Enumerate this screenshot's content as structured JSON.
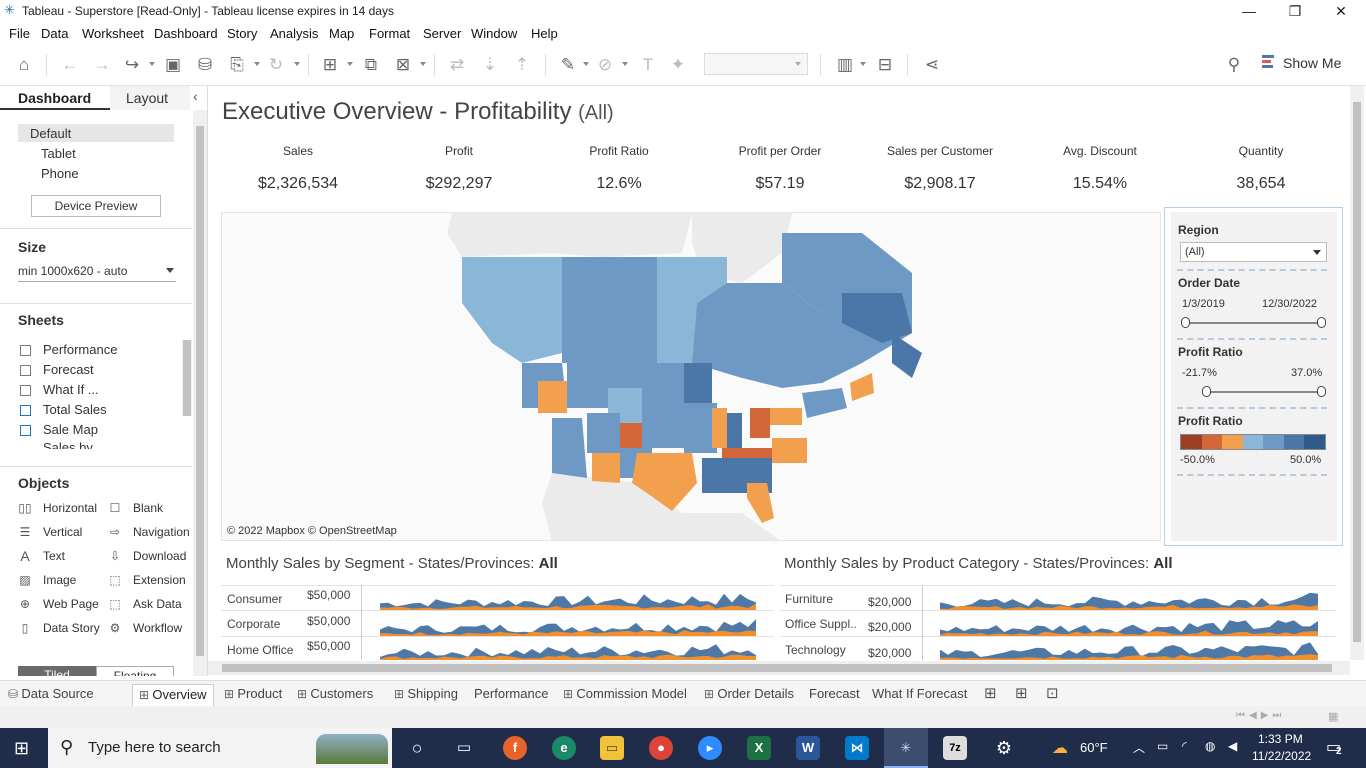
{
  "window": {
    "title": "Tableau - Superstore [Read-Only] - Tableau license expires in 14 days",
    "minimize": "—",
    "restore": "❐",
    "close": "✕"
  },
  "menu": [
    "File",
    "Data",
    "Worksheet",
    "Dashboard",
    "Story",
    "Analysis",
    "Map",
    "Format",
    "Server",
    "Window",
    "Help"
  ],
  "toolbar": {
    "show_me_label": "Show Me",
    "icons": [
      "home-icon",
      "back-icon",
      "forward-icon",
      "redo-icon",
      "save-icon",
      "new-datasource-icon",
      "pause-updates-icon",
      "refresh-icon",
      "new-worksheet-icon",
      "duplicate-icon",
      "clear-icon",
      "swap-icon",
      "sort-ascending-icon",
      "sort-descending-icon",
      "highlight-icon",
      "group-icon",
      "label-icon",
      "pin-icon",
      "chart-icon",
      "presentation-icon",
      "share-icon",
      "binoculars-icon"
    ]
  },
  "left_pane": {
    "tabs": [
      "Dashboard",
      "Layout"
    ],
    "devices": [
      "Default",
      "Tablet",
      "Phone"
    ],
    "device_preview_label": "Device Preview",
    "size_heading": "Size",
    "size_value": "min 1000x620 - auto",
    "sheets_heading": "Sheets",
    "sheets": [
      "Performance",
      "Forecast",
      "What If ...",
      "Total Sales",
      "Sale Map",
      "Sales by ..."
    ],
    "objects_heading": "Objects",
    "objects_left": [
      {
        "label": "Horizontal",
        "icon": "horizontal-container-icon"
      },
      {
        "label": "Vertical",
        "icon": "vertical-container-icon"
      },
      {
        "label": "Text",
        "icon": "text-icon"
      },
      {
        "label": "Image",
        "icon": "image-icon"
      },
      {
        "label": "Web Page",
        "icon": "web-page-icon"
      },
      {
        "label": "Data Story",
        "icon": "data-story-icon"
      }
    ],
    "objects_right": [
      {
        "label": "Blank",
        "icon": "blank-icon"
      },
      {
        "label": "Navigation",
        "icon": "navigation-icon"
      },
      {
        "label": "Download",
        "icon": "download-icon"
      },
      {
        "label": "Extension",
        "icon": "extension-icon"
      },
      {
        "label": "Ask Data",
        "icon": "ask-data-icon"
      },
      {
        "label": "Workflow",
        "icon": "workflow-icon"
      }
    ],
    "layout_buttons": [
      "Tiled",
      "Floating"
    ]
  },
  "dashboard": {
    "title": "Executive Overview - Profitability",
    "title_suffix": "(All)",
    "kpis": [
      {
        "label": "Sales",
        "value": "$2,326,534"
      },
      {
        "label": "Profit",
        "value": "$292,297"
      },
      {
        "label": "Profit Ratio",
        "value": "12.6%"
      },
      {
        "label": "Profit per Order",
        "value": "$57.19"
      },
      {
        "label": "Sales per Customer",
        "value": "$2,908.17"
      },
      {
        "label": "Avg. Discount",
        "value": "15.54%"
      },
      {
        "label": "Quantity",
        "value": "38,654"
      }
    ],
    "map_credit": "© 2022 Mapbox © OpenStreetMap",
    "map_colors": {
      "negative_strong": "#d4673a",
      "negative": "#f2a04e",
      "neutral_light": "#8ab6d8",
      "positive": "#6e99c4",
      "positive_strong": "#4a77a8"
    }
  },
  "filters": {
    "region_heading": "Region",
    "region_value": "(All)",
    "order_date_heading": "Order Date",
    "order_date_min": "1/3/2019",
    "order_date_max": "12/30/2022",
    "profit_ratio_heading": "Profit Ratio",
    "profit_ratio_min": "-21.7%",
    "profit_ratio_max": "37.0%",
    "legend_heading": "Profit Ratio",
    "legend_min": "-50.0%",
    "legend_max": "50.0%",
    "legend_colors": [
      "#9c3f23",
      "#d4673a",
      "#f2a04e",
      "#8ab6d8",
      "#6e99c4",
      "#4a77a8",
      "#2f5a8a"
    ]
  },
  "segment_chart": {
    "title_prefix": "Monthly Sales by Segment - States/Provinces:",
    "title_value": "All",
    "rows": [
      {
        "label": "Consumer",
        "value": "$50,000"
      },
      {
        "label": "Corporate",
        "value": "$50,000"
      },
      {
        "label": "Home Office",
        "value": "$50,000"
      }
    ],
    "series_colors": [
      "#4e79a7",
      "#f28e2b"
    ]
  },
  "category_chart": {
    "title_prefix": "Monthly Sales by Product Category - States/Provinces:",
    "title_value": "All",
    "rows": [
      {
        "label": "Furniture",
        "value": "$20,000"
      },
      {
        "label": "Office Suppl..",
        "value": "$20,000"
      },
      {
        "label": "Technology",
        "value": "$20,000"
      }
    ],
    "series_colors": [
      "#4e79a7",
      "#f28e2b"
    ]
  },
  "sheet_tabs": [
    "Data Source",
    "Overview",
    "Product",
    "Customers",
    "Shipping",
    "Performance",
    "Commission Model",
    "Order Details",
    "Forecast",
    "What If Forecast"
  ],
  "taskbar": {
    "search_placeholder": "Type here to search",
    "weather": "60°F",
    "time": "1:33 PM",
    "date": "11/22/2022",
    "notifications": "2",
    "apps": [
      "task-view-icon",
      "firefox-icon",
      "edge-icon",
      "file-explorer-icon",
      "chrome-icon",
      "zoom-icon",
      "excel-icon",
      "word-icon",
      "vscode-icon",
      "tableau-icon",
      "7zip-icon",
      "settings-icon"
    ]
  }
}
